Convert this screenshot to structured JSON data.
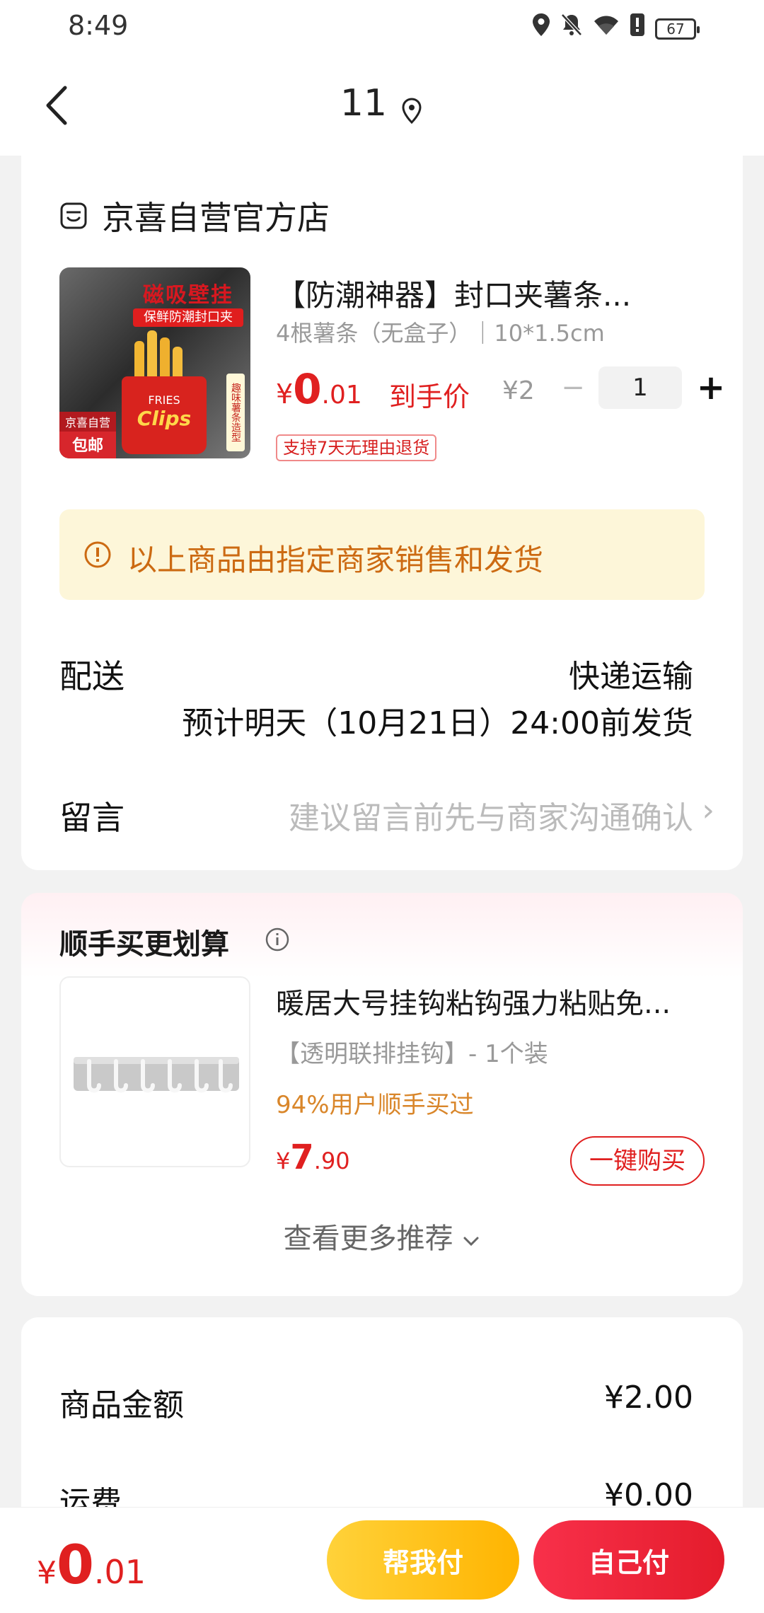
{
  "status_bar": {
    "time": "8:49",
    "battery": "67"
  },
  "header": {
    "title": "11"
  },
  "store": {
    "name": "京喜自营官方店",
    "product": {
      "image_title": "磁吸壁挂",
      "image_subtitle": "保鲜防潮封口夹",
      "image_box_line1": "FRIES",
      "image_box_line2": "Clips",
      "image_side_text": "趣味薯条造型",
      "image_badge_line1": "京喜自营",
      "image_badge_line2": "包邮",
      "title": "【防潮神器】封口夹薯条...",
      "spec": "4根薯条（无盒子）｜10*1.5cm",
      "price_symbol": "¥",
      "price_int": "0",
      "price_dec": ".01",
      "price_label": "到手价",
      "original_price": "¥2",
      "quantity": "1",
      "return_tag": "支持7天无理由退货"
    },
    "notice": "以上商品由指定商家销售和发货",
    "delivery": {
      "label": "配送",
      "method": "快递运输",
      "time": "预计明天（10月21日）24:00前发货"
    },
    "message": {
      "label": "留言",
      "placeholder": "建议留言前先与商家沟通确认"
    }
  },
  "recommend": {
    "title": "顺手买更划算",
    "item": {
      "name": "暖居大号挂钩粘钩强力粘贴免...",
      "spec": "【透明联排挂钩】- 1个装",
      "stat": "94%用户顺手买过",
      "price_symbol": "¥",
      "price_int": "7",
      "price_dec": ".90",
      "buy_label": "一键购买"
    },
    "more_label": "查看更多推荐"
  },
  "summary": {
    "goods_amount_label": "商品金额",
    "goods_amount": "¥2.00",
    "shipping_label": "运费",
    "shipping_amount": "¥0.00"
  },
  "bottom_bar": {
    "total_symbol": "¥",
    "total_int": "0",
    "total_dec": ".01",
    "help_pay_label": "帮我付",
    "self_pay_label": "自己付"
  },
  "colors": {
    "accent_red": "#e02020",
    "notice_bg": "#fdf6d9",
    "notice_text": "#cc6a12",
    "help_btn": "#ffc21a",
    "self_btn": "#ee2438"
  }
}
